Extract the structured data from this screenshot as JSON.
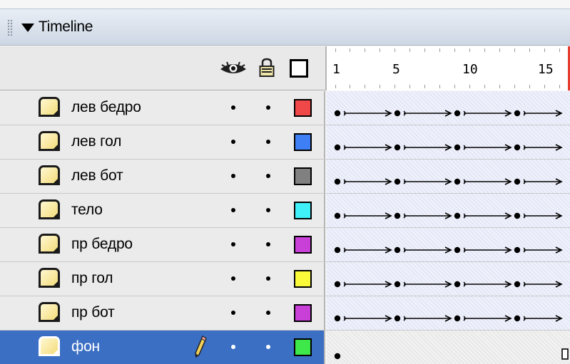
{
  "panel": {
    "title": "Timeline",
    "icons": {
      "collapse": "triangle-down-icon",
      "gripper": "gripper-icon",
      "eye": "eye-icon",
      "lock": "lock-icon",
      "outline": "outline-icon"
    }
  },
  "ruler": {
    "frame_numbers": [
      "1",
      "5",
      "10",
      "15"
    ]
  },
  "layers": [
    {
      "name": "лев бедро",
      "color": "#f04848",
      "selected": false,
      "frames": "tween"
    },
    {
      "name": "лев гол",
      "color": "#3f7ff5",
      "selected": false,
      "frames": "tween"
    },
    {
      "name": "лев бот",
      "color": "#808080",
      "selected": false,
      "frames": "tween"
    },
    {
      "name": "тело",
      "color": "#40f0f8",
      "selected": false,
      "frames": "tween"
    },
    {
      "name": "пр бедро",
      "color": "#c840d8",
      "selected": false,
      "frames": "tween"
    },
    {
      "name": "пр гол",
      "color": "#fafa3a",
      "selected": false,
      "frames": "tween"
    },
    {
      "name": "пр бот",
      "color": "#c840d8",
      "selected": false,
      "frames": "tween"
    },
    {
      "name": "фон",
      "color": "#3ee84a",
      "selected": true,
      "frames": "static"
    }
  ],
  "colors": {
    "selection": "#3b6fc4",
    "playhead": "#e63b2e"
  }
}
